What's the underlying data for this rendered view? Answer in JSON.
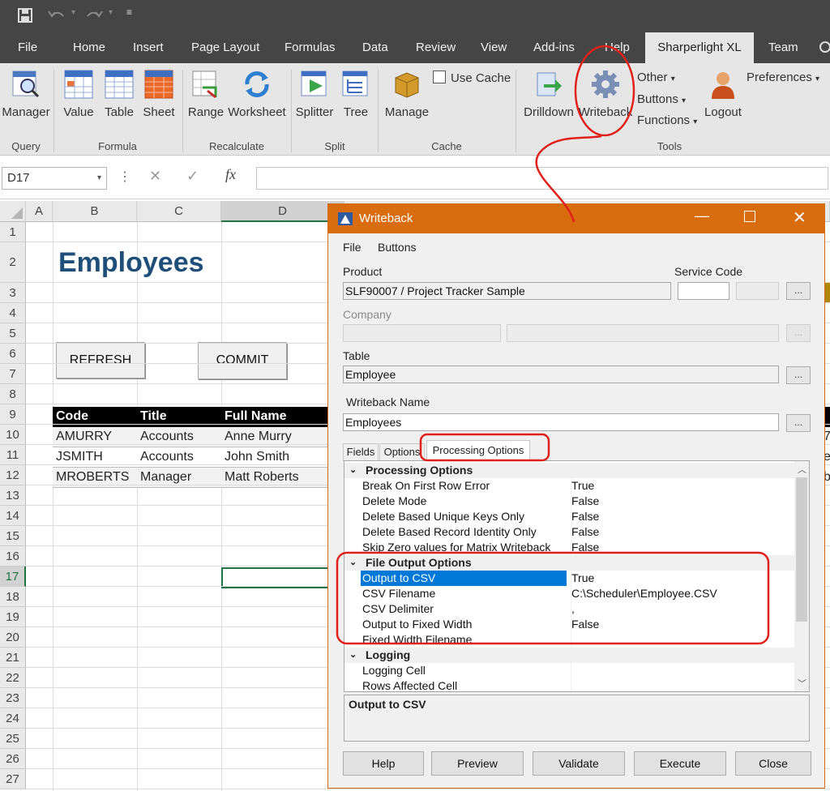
{
  "colors": {
    "excel_dark": "#454545",
    "ribbon": "#e6e6e6",
    "dialog_title": "#d86c0e",
    "selection": "#0078d7",
    "annotation": "#e0201a",
    "heading": "#1f4e79"
  },
  "ribbon_tabs": [
    "File",
    "Home",
    "Insert",
    "Page Layout",
    "Formulas",
    "Data",
    "Review",
    "View",
    "Add-ins",
    "Help",
    "Sharperlight XL",
    "Team"
  ],
  "active_tab": "Sharperlight XL",
  "ribbon": {
    "buttons": {
      "manager": "Manager",
      "value": "Value",
      "table": "Table",
      "sheet": "Sheet",
      "range": "Range",
      "worksheet": "Worksheet",
      "splitter": "Splitter",
      "tree": "Tree",
      "manage": "Manage",
      "drilldown": "Drilldown",
      "writeback": "Writeback",
      "logout": "Logout"
    },
    "use_cache": "Use Cache",
    "other": "Other",
    "buttons_menu": "Buttons",
    "functions": "Functions",
    "preferences": "Preferences",
    "groups": {
      "query": "Query",
      "formula": "Formula",
      "recalculate": "Recalculate",
      "split": "Split",
      "cache": "Cache",
      "tools": "Tools"
    }
  },
  "formula_bar": {
    "name_box": "D17",
    "fx": "fx"
  },
  "sheet": {
    "columns": [
      "A",
      "B",
      "C",
      "D"
    ],
    "rows": [
      "1",
      "2",
      "3",
      "4",
      "5",
      "6",
      "7",
      "8",
      "9",
      "10",
      "11",
      "12",
      "13",
      "14",
      "15",
      "16",
      "17",
      "18",
      "19",
      "20",
      "21",
      "22",
      "23",
      "24",
      "25",
      "26",
      "27"
    ],
    "heading": "Employees",
    "refresh_button": "REFRESH",
    "commit_button": "COMMIT",
    "table_headers": [
      "Code",
      "Title",
      "Full Name"
    ],
    "table_rows": [
      [
        "AMURRY",
        "Accounts",
        "Anne Murry"
      ],
      [
        "JSMITH",
        "Accounts",
        "John Smith"
      ],
      [
        "MROBERTS",
        "Manager",
        "Matt Roberts"
      ]
    ],
    "edge_peek": [
      "7",
      "e",
      "b"
    ]
  },
  "dialog": {
    "title": "Writeback",
    "menu": [
      "File",
      "Buttons"
    ],
    "product_label": "Product",
    "product_value": "SLF90007 / Project Tracker Sample",
    "service_code_label": "Service Code",
    "company_label": "Company",
    "table_label": "Table",
    "table_value": "Employee",
    "writeback_name_label": "Writeback Name",
    "writeback_name_value": "Employees",
    "ellipsis": "...",
    "tabs": [
      "Fields",
      "Options",
      "Processing Options"
    ],
    "categories": {
      "processing": "Processing Options",
      "file_output": "File Output Options",
      "logging": "Logging"
    },
    "processing_props": [
      {
        "name": "Break On First Row Error",
        "value": "True"
      },
      {
        "name": "Delete Mode",
        "value": "False"
      },
      {
        "name": "Delete Based Unique Keys Only",
        "value": "False"
      },
      {
        "name": "Delete Based Record Identity Only",
        "value": "False"
      },
      {
        "name": "Skip Zero values for Matrix Writeback",
        "value": "False"
      }
    ],
    "file_output_props": [
      {
        "name": "Output to CSV",
        "value": "True"
      },
      {
        "name": "CSV Filename",
        "value": "C:\\Scheduler\\Employee.CSV"
      },
      {
        "name": "CSV Delimiter",
        "value": ","
      },
      {
        "name": "Output to Fixed Width",
        "value": "False"
      },
      {
        "name": "Fixed Width Filename",
        "value": ""
      }
    ],
    "logging_props": [
      {
        "name": "Logging Cell",
        "value": ""
      },
      {
        "name": "Rows Affected Cell",
        "value": ""
      }
    ],
    "description_title": "Output to CSV",
    "buttons": [
      "Help",
      "Preview",
      "Validate",
      "Execute",
      "Close"
    ]
  }
}
